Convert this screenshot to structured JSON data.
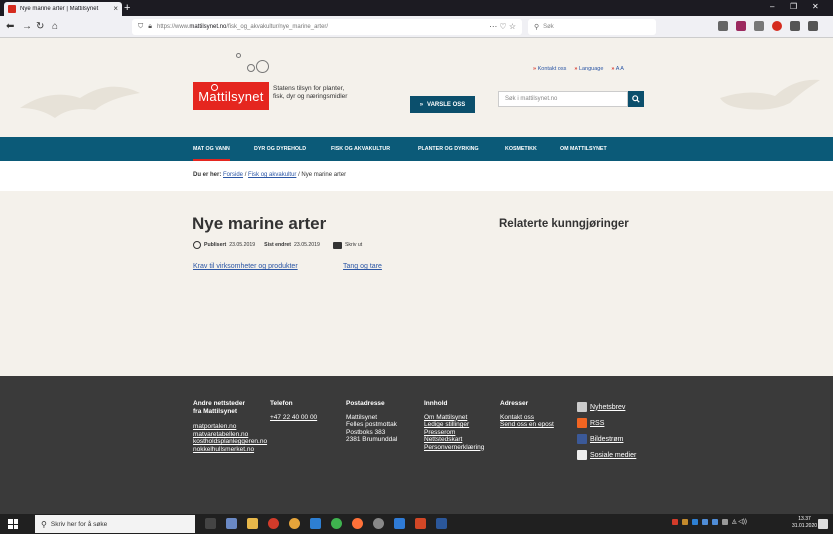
{
  "browser": {
    "tab_title": "Nye marine arter | Mattilsynet",
    "url_prefix": "https://www.",
    "url_domain": "mattilsynet.no",
    "url_path": "/fisk_og_akvakultur/nye_marine_arter/",
    "search_placeholder": "Søk"
  },
  "header": {
    "logo_text": "Mattilsynet",
    "tagline": "Statens tilsyn for planter, fisk, dyr og næringsmidler",
    "varsle_label": "VARSLE OSS",
    "top_links": [
      "Kontakt oss",
      "Language",
      "A A"
    ],
    "search_placeholder": "Søk i mattilsynet.no"
  },
  "mainnav": {
    "items": [
      "MAT OG VANN",
      "DYR OG DYREHOLD",
      "FISK OG AKVAKULTUR",
      "PLANTER OG DYRKING",
      "KOSMETIKK",
      "OM MATTILSYNET"
    ]
  },
  "breadcrumb": {
    "label": "Du er her:",
    "home": "Forside",
    "section": "Fisk og akvakultur",
    "current": "Nye marine arter"
  },
  "article": {
    "title": "Nye marine arter",
    "published_label": "Publisert",
    "published_date": "23.05.2019",
    "modified_label": "Sist endret",
    "modified_date": "23.05.2019",
    "print_label": "Skriv ut",
    "tags": [
      "Krav til virksomheter og produkter",
      "Tang og tare"
    ]
  },
  "related": {
    "title": "Relaterte kunngjøringer"
  },
  "footer": {
    "col1": {
      "head1": "Andre nettsteder",
      "head2": "fra Mattilsynet",
      "links": [
        "matportalen.no",
        "matvaretabellen.no",
        "kostholdsplanleggeren.no",
        "nokkelhullsmerket.no"
      ]
    },
    "col2": {
      "head": "Telefon",
      "phone": "+47 22 40 00 00"
    },
    "col3": {
      "head": "Postadresse",
      "lines": [
        "Mattilsynet",
        "Felles postmottak",
        "Postboks 383",
        "2381 Brumunddal"
      ]
    },
    "col4": {
      "head": "Innhold",
      "links": [
        "Om Mattilsynet",
        "Ledige stillinger",
        "Presserom",
        "Nettstedskart",
        "Personvernerklæring"
      ]
    },
    "col5": {
      "head": "Adresser",
      "links": [
        "Kontakt oss",
        "Send oss en epost"
      ]
    },
    "social": [
      "Nyhetsbrev",
      "RSS",
      "Bildestrøm",
      "Sosiale medier"
    ]
  },
  "taskbar": {
    "search_placeholder": "Skriv her for å søke",
    "time": "13.37",
    "date": "31.01.2020"
  },
  "colors": {
    "brand_red": "#e5261f",
    "brand_blue": "#0b5a78",
    "link_blue": "#2b56a5"
  }
}
